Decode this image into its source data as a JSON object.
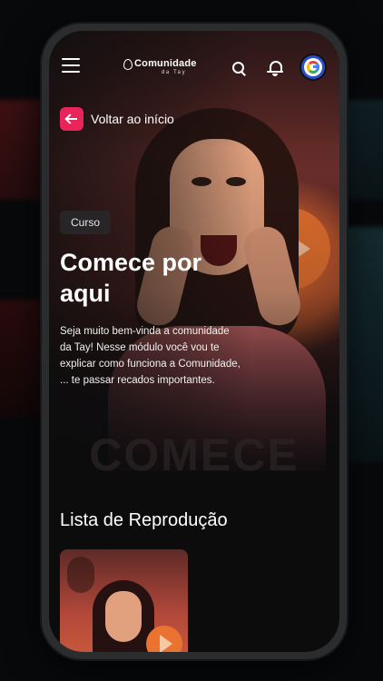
{
  "header": {
    "logo_name": "Comunidade",
    "logo_sub": "da Tay"
  },
  "back_link": {
    "label": "Voltar ao início"
  },
  "hero": {
    "tag": "Curso",
    "title": "Comece por aqui",
    "description": "Seja muito bem-vinda a comunidade da Tay! Nesse módulo você vou te explicar como funciona a Comunidade, ... te passar recados importantes.",
    "watermark": "COMECE"
  },
  "playlist": {
    "title": "Lista de Reprodução"
  },
  "colors": {
    "accent": "#e8245a",
    "background": "#0c0c0d",
    "play_orange": "#e9732f"
  },
  "icons": [
    "menu-icon",
    "search-icon",
    "bell-icon",
    "google-avatar-icon",
    "arrow-left-icon",
    "play-icon"
  ]
}
